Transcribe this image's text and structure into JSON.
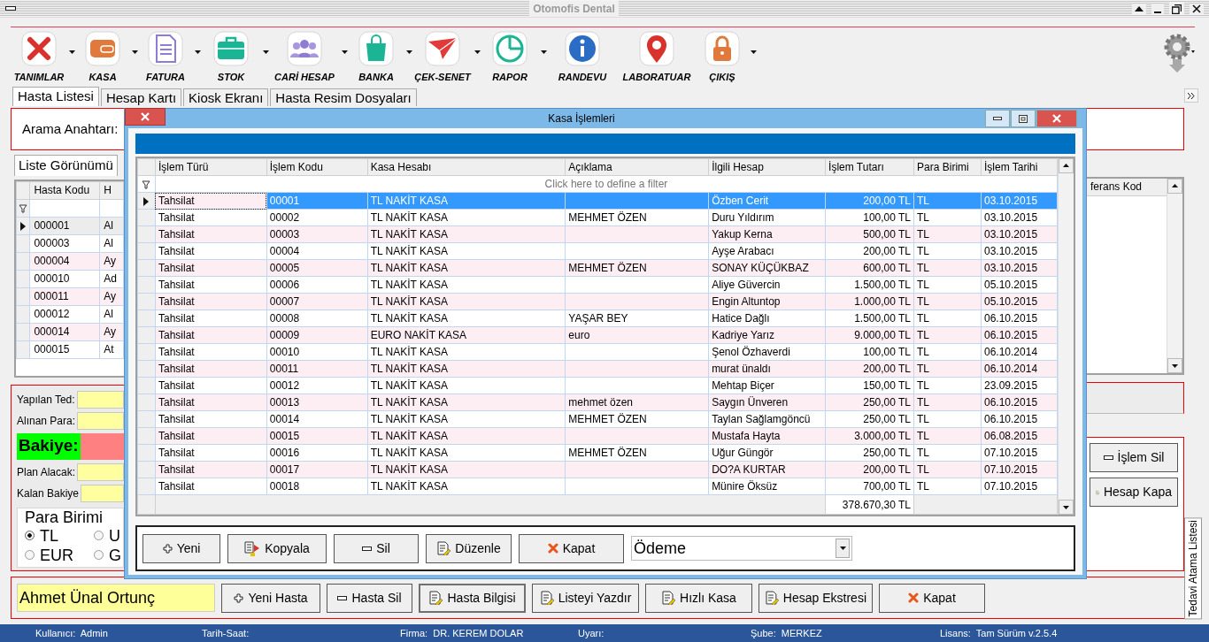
{
  "window": {
    "title": "Otomofis Dental"
  },
  "toolbar": [
    {
      "label": "TANIMLAR",
      "kind": "tools",
      "menu": true
    },
    {
      "label": "KASA",
      "kind": "wallet",
      "menu": true
    },
    {
      "label": "FATURA",
      "kind": "document",
      "menu": true
    },
    {
      "label": "STOK",
      "kind": "briefcase",
      "menu": true
    },
    {
      "label": "CARİ HESAP",
      "kind": "people",
      "menu": true
    },
    {
      "label": "BANKA",
      "kind": "bag",
      "menu": true
    },
    {
      "label": "ÇEK-SENET",
      "kind": "plane",
      "menu": true
    },
    {
      "label": "RAPOR",
      "kind": "pie",
      "menu": true
    },
    {
      "label": "RANDEVU",
      "kind": "info",
      "menu": false
    },
    {
      "label": "LABORATUAR",
      "kind": "pin",
      "menu": false
    },
    {
      "label": "ÇIKIŞ",
      "kind": "lock",
      "menu": true
    }
  ],
  "tabs": [
    {
      "label": "Hasta Listesi",
      "selected": true
    },
    {
      "label": "Hesap Kartı",
      "selected": false
    },
    {
      "label": "Kiosk Ekranı",
      "selected": false
    },
    {
      "label": "Hasta Resim Dosyaları",
      "selected": false
    }
  ],
  "search": {
    "label": "Arama Anahtarı:"
  },
  "view_tab": {
    "label": "Liste Görünümü"
  },
  "patient_grid": {
    "columns": [
      "Hasta Kodu",
      "H"
    ],
    "rows": [
      {
        "code": "000001",
        "name": "Al",
        "selected": true
      },
      {
        "code": "000003",
        "name": "Al",
        "selected": false
      },
      {
        "code": "000004",
        "name": "Ay",
        "selected": false
      },
      {
        "code": "000010",
        "name": "Ad",
        "selected": false
      },
      {
        "code": "000011",
        "name": "Ay",
        "selected": false
      },
      {
        "code": "000012",
        "name": "Al",
        "selected": false
      },
      {
        "code": "000014",
        "name": "Ay",
        "selected": false
      },
      {
        "code": "000015",
        "name": "At",
        "selected": false
      }
    ]
  },
  "right_grid": {
    "column": "ferans Kod"
  },
  "summary": {
    "fields": [
      {
        "label": "Yapılan Ted:",
        "kind": "plain"
      },
      {
        "label": "Alınan Para:",
        "kind": "plain"
      },
      {
        "label": "Bakiye:",
        "kind": "balance"
      },
      {
        "label": "Plan Alacak:",
        "kind": "plain"
      },
      {
        "label": "Kalan Bakiye",
        "kind": "plain"
      }
    ],
    "currency": {
      "title": "Para Birimi",
      "options": [
        {
          "label": "TL",
          "selected": true
        },
        {
          "label": "U",
          "selected": false
        },
        {
          "label": "EUR",
          "selected": false
        },
        {
          "label": "G",
          "selected": false
        }
      ]
    }
  },
  "side_buttons": [
    {
      "label": "İşlem Sil",
      "kind": "minus"
    },
    {
      "label": "Hesap Kapa",
      "kind": "edit"
    }
  ],
  "side_tab": {
    "label": "Tedavi Atama Listesi"
  },
  "patient_name": "Ahmet Ünal Ortunç",
  "bottom_buttons": [
    {
      "label": "Yeni Hasta",
      "kind": "plus",
      "default": false
    },
    {
      "label": "Hasta Sil",
      "kind": "minus",
      "default": false
    },
    {
      "label": "Hasta Bilgisi",
      "kind": "edit",
      "default": true
    },
    {
      "label": "Listeyi Yazdır",
      "kind": "edit",
      "default": false
    },
    {
      "label": "Hızlı Kasa",
      "kind": "edit",
      "default": false
    },
    {
      "label": "Hesap Ekstresi",
      "kind": "edit",
      "default": false
    },
    {
      "label": "Kapat",
      "kind": "close",
      "default": false
    }
  ],
  "status_bar": [
    {
      "label": "Kullanıcı:",
      "value": "Admin"
    },
    {
      "label": "Tarih-Saat:"
    },
    {
      "label": "Firma:",
      "value": "DR. KEREM DOLAR"
    },
    {
      "label": "Uyarı:"
    },
    {
      "label": "Şube:",
      "value": "MERKEZ"
    },
    {
      "label": "Lisans:",
      "value": "Tam Sürüm v.2.5.4"
    }
  ],
  "dialog": {
    "title": "Kasa İşlemleri",
    "columns": [
      "İşlem Türü",
      "İşlem Kodu",
      "Kasa Hesabı",
      "Açıklama",
      "İlgili Hesap",
      "İşlem Tutarı",
      "Para Birimi",
      "İşlem Tarihi"
    ],
    "filter_hint": "Click here to define a filter",
    "rows": [
      {
        "type": "Tahsilat",
        "code": "00001",
        "account": "TL NAKİT KASA",
        "related": "Özben Cerit",
        "amount": "200,00 TL",
        "currency": "TL",
        "date": "03.10.2015",
        "selected": true
      },
      {
        "type": "Tahsilat",
        "code": "00002",
        "account": "TL NAKİT KASA",
        "description": "MEHMET ÖZEN",
        "related": "Duru Yıldırım",
        "amount": "100,00 TL",
        "currency": "TL",
        "date": "03.10.2015",
        "selected": false
      },
      {
        "type": "Tahsilat",
        "code": "00003",
        "account": "TL NAKİT KASA",
        "related": "Yakup Kerna",
        "amount": "500,00 TL",
        "currency": "TL",
        "date": "03.10.2015",
        "selected": false
      },
      {
        "type": "Tahsilat",
        "code": "00004",
        "account": "TL NAKİT KASA",
        "related": "Ayşe Arabacı",
        "amount": "200,00 TL",
        "currency": "TL",
        "date": "03.10.2015",
        "selected": false
      },
      {
        "type": "Tahsilat",
        "code": "00005",
        "account": "TL NAKİT KASA",
        "description": "MEHMET ÖZEN",
        "related": "SONAY KÜÇÜKBAZ",
        "amount": "600,00 TL",
        "currency": "TL",
        "date": "03.10.2015",
        "selected": false
      },
      {
        "type": "Tahsilat",
        "code": "00006",
        "account": "TL NAKİT KASA",
        "related": "Aliye Güvercin",
        "amount": "1.500,00 TL",
        "currency": "TL",
        "date": "05.10.2015",
        "selected": false
      },
      {
        "type": "Tahsilat",
        "code": "00007",
        "account": "TL NAKİT KASA",
        "related": "Engin Altuntop",
        "amount": "1.000,00 TL",
        "currency": "TL",
        "date": "05.10.2015",
        "selected": false
      },
      {
        "type": "Tahsilat",
        "code": "00008",
        "account": "TL NAKİT KASA",
        "description": "YAŞAR BEY",
        "related": "Hatice Dağlı",
        "amount": "1.500,00 TL",
        "currency": "TL",
        "date": "06.10.2015",
        "selected": false
      },
      {
        "type": "Tahsilat",
        "code": "00009",
        "account": "EURO NAKİT KASA",
        "description": "euro",
        "related": "Kadriye Yarız",
        "amount": "9.000,00 TL",
        "currency": "TL",
        "date": "06.10.2015",
        "selected": false
      },
      {
        "type": "Tahsilat",
        "code": "00010",
        "account": "TL NAKİT KASA",
        "related": "Şenol Özhaverdi",
        "amount": "100,00 TL",
        "currency": "TL",
        "date": "06.10.2014",
        "selected": false
      },
      {
        "type": "Tahsilat",
        "code": "00011",
        "account": "TL NAKİT KASA",
        "related": "murat ünaldı",
        "amount": "200,00 TL",
        "currency": "TL",
        "date": "06.10.2014",
        "selected": false
      },
      {
        "type": "Tahsilat",
        "code": "00012",
        "account": "TL NAKİT KASA",
        "related": "Mehtap Biçer",
        "amount": "150,00 TL",
        "currency": "TL",
        "date": "23.09.2015",
        "selected": false
      },
      {
        "type": "Tahsilat",
        "code": "00013",
        "account": "TL NAKİT KASA",
        "description": "mehmet özen",
        "related": "Saygın Ünveren",
        "amount": "250,00 TL",
        "currency": "TL",
        "date": "06.10.2015",
        "selected": false
      },
      {
        "type": "Tahsilat",
        "code": "00014",
        "account": "TL NAKİT KASA",
        "description": "MEHMET ÖZEN",
        "related": "Taylan Sağlamgöncü",
        "amount": "250,00 TL",
        "currency": "TL",
        "date": "06.10.2015",
        "selected": false
      },
      {
        "type": "Tahsilat",
        "code": "00015",
        "account": "TL NAKİT KASA",
        "related": "Mustafa Hayta",
        "amount": "3.000,00 TL",
        "currency": "TL",
        "date": "06.08.2015",
        "selected": false
      },
      {
        "type": "Tahsilat",
        "code": "00016",
        "account": "TL NAKİT KASA",
        "description": "MEHMET ÖZEN",
        "related": "Uğur Güngör",
        "amount": "250,00 TL",
        "currency": "TL",
        "date": "07.10.2015",
        "selected": false
      },
      {
        "type": "Tahsilat",
        "code": "00017",
        "account": "TL NAKİT KASA",
        "related": "DO?A KURTAR",
        "amount": "200,00 TL",
        "currency": "TL",
        "date": "07.10.2015",
        "selected": false
      },
      {
        "type": "Tahsilat",
        "code": "00018",
        "account": "TL NAKİT KASA",
        "related": "Münire Öksüz",
        "amount": "700,00 TL",
        "currency": "TL",
        "date": "07.10.2015",
        "selected": false
      }
    ],
    "total": "378.670,30 TL",
    "buttons": [
      {
        "label": "Yeni",
        "kind": "plus"
      },
      {
        "label": "Kopyala",
        "kind": "copy"
      },
      {
        "label": "Sil",
        "kind": "minus"
      },
      {
        "label": "Düzenle",
        "kind": "edit"
      },
      {
        "label": "Kapat",
        "kind": "close"
      }
    ],
    "dropdown": {
      "value": "Ödeme"
    }
  }
}
